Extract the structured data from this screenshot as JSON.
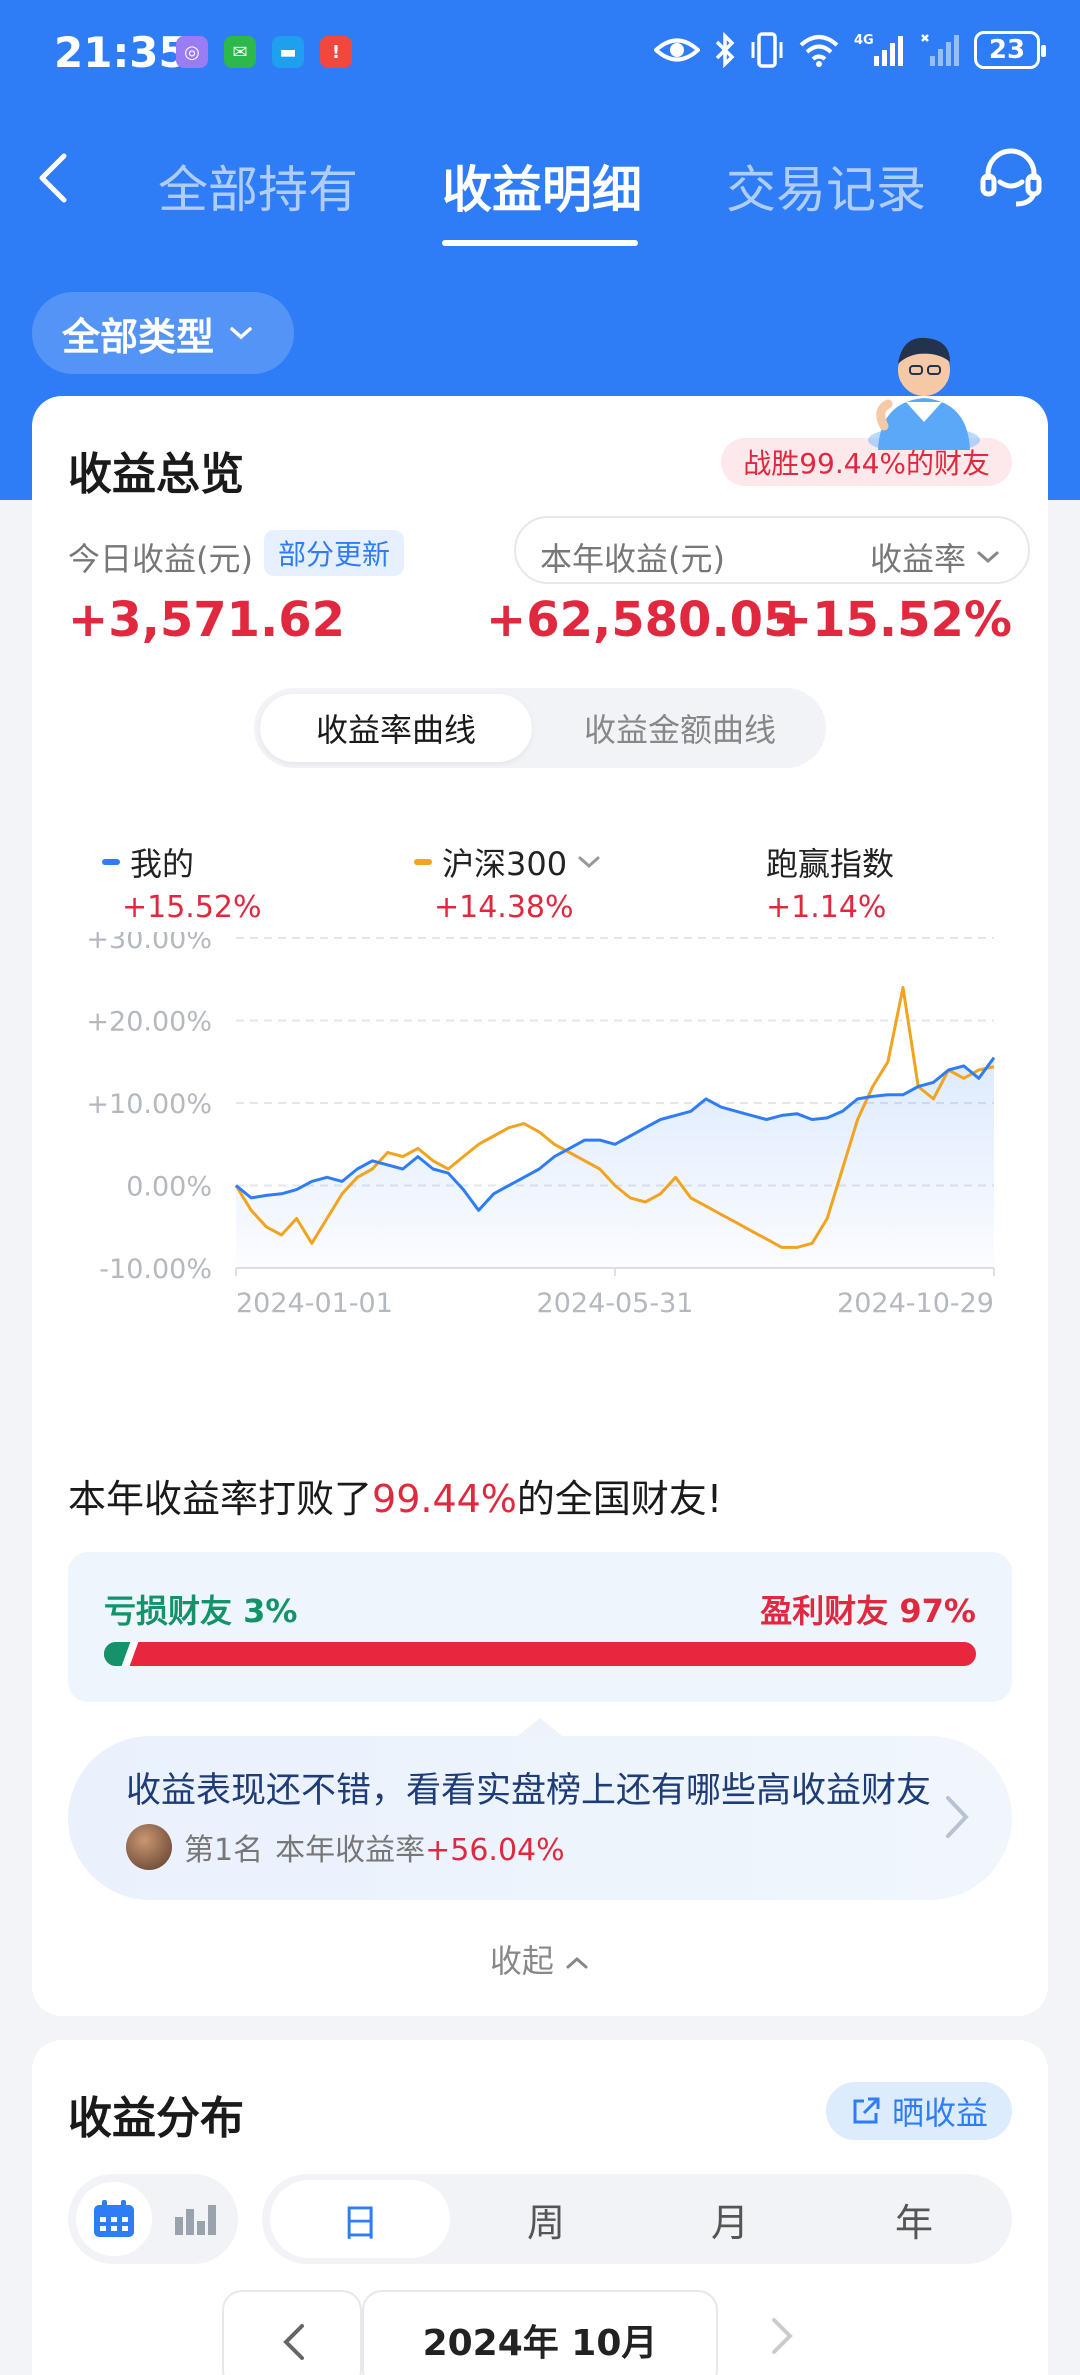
{
  "status_bar": {
    "time": "21:35",
    "battery": "23",
    "network": "4G"
  },
  "nav": {
    "tabs": [
      {
        "label": "全部持有",
        "active": false
      },
      {
        "label": "收益明细",
        "active": true
      },
      {
        "label": "交易记录",
        "active": false
      }
    ]
  },
  "type_filter": {
    "label": "全部类型"
  },
  "overview": {
    "title": "收益总览",
    "win_badge": "战胜99.44%的财友",
    "today_label": "今日收益(元)",
    "partial_update": "部分更新",
    "today_value": "+3,571.62",
    "year_label": "本年收益(元)",
    "rate_label": "收益率",
    "year_value": "+62,580.05",
    "rate_value": "+15.52%",
    "toggle": {
      "rate_curve": "收益率曲线",
      "amount_curve": "收益金额曲线"
    },
    "legend": {
      "mine_name": "我的",
      "mine_value": "+15.52%",
      "index_name": "沪深300",
      "index_value": "+14.38%",
      "beat_name": "跑赢指数",
      "beat_value": "+1.14%"
    },
    "beat_text": {
      "prefix": "本年收益率打败了",
      "pct": "99.44%",
      "suffix": "的全国财友!"
    },
    "distribution": {
      "loss_label": "亏损财友 3%",
      "win_label": "盈利财友 97%",
      "loss_pct": 3,
      "win_pct": 97
    },
    "rank": {
      "title": "收益表现还不错，看看实盘榜上还有哪些高收益财友",
      "position": "第1名",
      "rate_label": "本年收益率",
      "rate_value": "+56.04%"
    },
    "collapse": "收起"
  },
  "chart_data": {
    "type": "line",
    "y_ticks": [
      "+30.00%",
      "+20.00%",
      "+10.00%",
      "0.00%",
      "-10.00%"
    ],
    "x_ticks": [
      "2024-01-01",
      "2024-05-31",
      "2024-10-29"
    ],
    "ylim": [
      -10,
      30
    ],
    "grid": true,
    "colors": {
      "mine": "#2f7df6",
      "index": "#f2a31f"
    },
    "series": [
      {
        "name": "我的",
        "color": "#2f7df6",
        "y": [
          0,
          -1.5,
          -1.2,
          -1,
          -0.5,
          0.5,
          1,
          0.5,
          2,
          3,
          2.5,
          2,
          3.5,
          2,
          1.5,
          -0.5,
          -3,
          -1,
          0,
          1,
          2,
          3.5,
          4.5,
          5.5,
          5.5,
          5,
          6,
          7,
          8,
          8.5,
          9,
          10.5,
          9.5,
          9,
          8.5,
          8,
          8.5,
          8.7,
          8,
          8.2,
          9,
          10.5,
          10.8,
          11,
          11,
          12,
          12.5,
          14,
          14.5,
          13,
          15.5
        ]
      },
      {
        "name": "沪深300",
        "color": "#f2a31f",
        "y": [
          0,
          -3,
          -5,
          -6,
          -4,
          -7,
          -4,
          -1,
          1,
          2,
          4,
          3.5,
          4.5,
          3,
          2,
          3.5,
          5,
          6,
          7,
          7.5,
          6.5,
          5,
          4,
          3,
          2,
          0,
          -1.5,
          -2,
          -1,
          1,
          -1.5,
          -2.5,
          -3.5,
          -4.5,
          -5.5,
          -6.5,
          -7.5,
          -7.5,
          -7,
          -4,
          2,
          8,
          12,
          15,
          24,
          12,
          10.5,
          14,
          13,
          14,
          14.4
        ]
      }
    ]
  },
  "distribution_section": {
    "title": "收益分布",
    "share_label": "晒收益",
    "periods": [
      "日",
      "周",
      "月",
      "年"
    ],
    "active_period": "日",
    "month": "2024年 10月"
  }
}
